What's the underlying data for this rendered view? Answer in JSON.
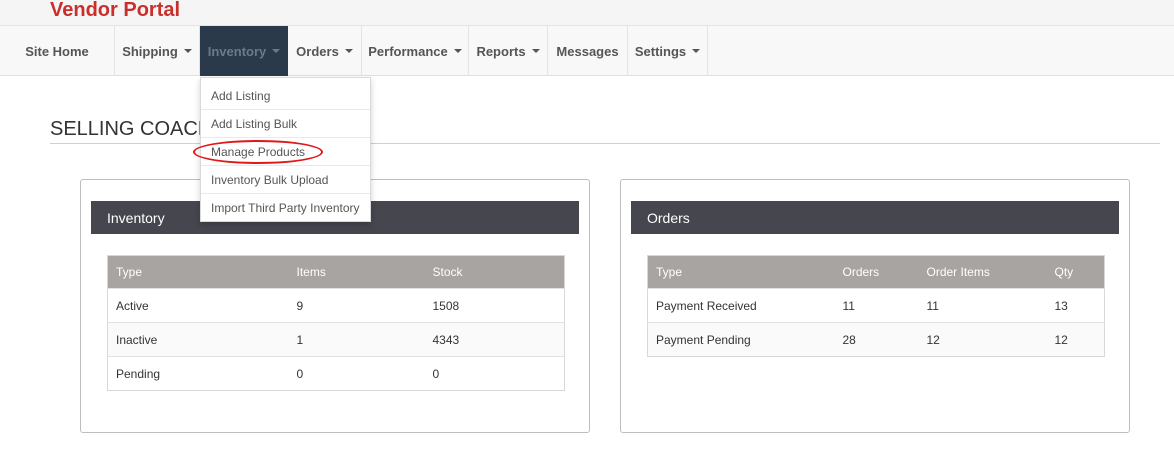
{
  "brand": "Vendor Portal",
  "nav": [
    {
      "label": "Site Home",
      "has_caret": false
    },
    {
      "label": "Shipping",
      "has_caret": true
    },
    {
      "label": "Inventory",
      "has_caret": true,
      "active": true
    },
    {
      "label": "Orders",
      "has_caret": true
    },
    {
      "label": "Performance",
      "has_caret": true
    },
    {
      "label": "Reports",
      "has_caret": true
    },
    {
      "label": "Messages",
      "has_caret": false
    },
    {
      "label": "Settings",
      "has_caret": true
    }
  ],
  "inventory_menu": [
    "Add Listing",
    "Add Listing Bulk",
    "Manage Products",
    "Inventory Bulk Upload",
    "Import Third Party Inventory"
  ],
  "page_title": "SELLING COACH",
  "inventory_card": {
    "title": "Inventory",
    "headers": [
      "Type",
      "Items",
      "Stock"
    ],
    "rows": [
      [
        "Active",
        "9",
        "1508"
      ],
      [
        "Inactive",
        "1",
        "4343"
      ],
      [
        "Pending",
        "0",
        "0"
      ]
    ]
  },
  "orders_card": {
    "title": "Orders",
    "headers": [
      "Type",
      "Orders",
      "Order Items",
      "Qty"
    ],
    "rows": [
      [
        "Payment Received",
        "11",
        "11",
        "13"
      ],
      [
        "Payment Pending",
        "28",
        "12",
        "12"
      ]
    ]
  },
  "colors": {
    "brand": "#c9302c",
    "nav_active_bg": "#2b3a4a",
    "card_header_bg": "#46464e",
    "table_header_bg": "#a8a4a1",
    "highlight_ring": "#e01818"
  }
}
